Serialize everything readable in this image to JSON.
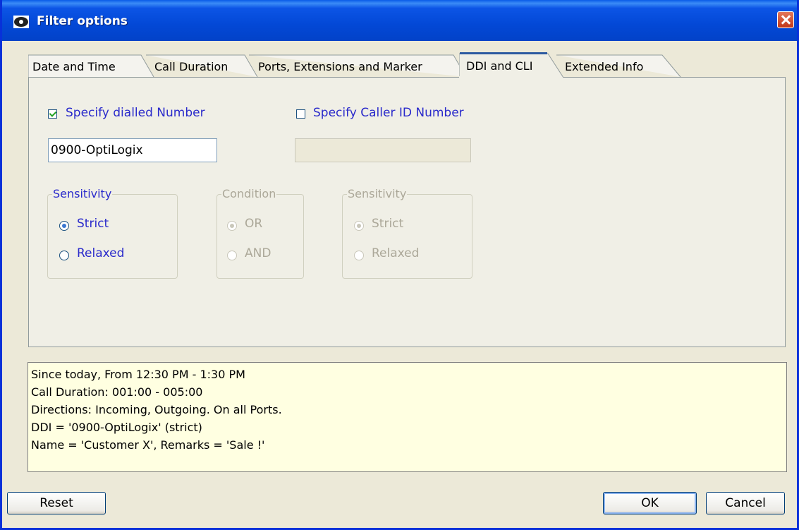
{
  "window": {
    "title": "Filter options"
  },
  "tabs": [
    {
      "label": "Date and Time",
      "active": false
    },
    {
      "label": "Call Duration",
      "active": false
    },
    {
      "label": "Ports, Extensions and Marker",
      "active": false
    },
    {
      "label": "DDI and CLI",
      "active": true
    },
    {
      "label": "Extended Info",
      "active": false
    }
  ],
  "ddi": {
    "checkbox_label": "Specify dialled Number",
    "checked": true,
    "value": "0900-OptiLogix",
    "sensitivity": {
      "title": "Sensitivity",
      "options": [
        "Strict",
        "Relaxed"
      ],
      "selected": "Strict"
    }
  },
  "condition": {
    "title": "Condition",
    "options": [
      "OR",
      "AND"
    ],
    "selected": "OR",
    "enabled": false
  },
  "cli": {
    "checkbox_label": "Specify Caller ID Number",
    "checked": false,
    "value": "",
    "sensitivity": {
      "title": "Sensitivity",
      "options": [
        "Strict",
        "Relaxed"
      ],
      "selected": "Strict",
      "enabled": false
    }
  },
  "summary": {
    "lines": [
      "Since today, From 12:30 PM - 1:30 PM",
      "Call Duration: 001:00 - 005:00",
      "Directions: Incoming, Outgoing.  On all Ports.",
      "DDI = '0900-OptiLogix' (strict)",
      "Name = 'Customer X', Remarks = 'Sale !'"
    ]
  },
  "buttons": {
    "reset": "Reset",
    "ok": "OK",
    "cancel": "Cancel"
  },
  "colors": {
    "titlebar": "#0348d6",
    "accent_label": "#2a2acb",
    "summary_bg": "#ffffe1",
    "active_tab_marker": "#e68b2c"
  }
}
